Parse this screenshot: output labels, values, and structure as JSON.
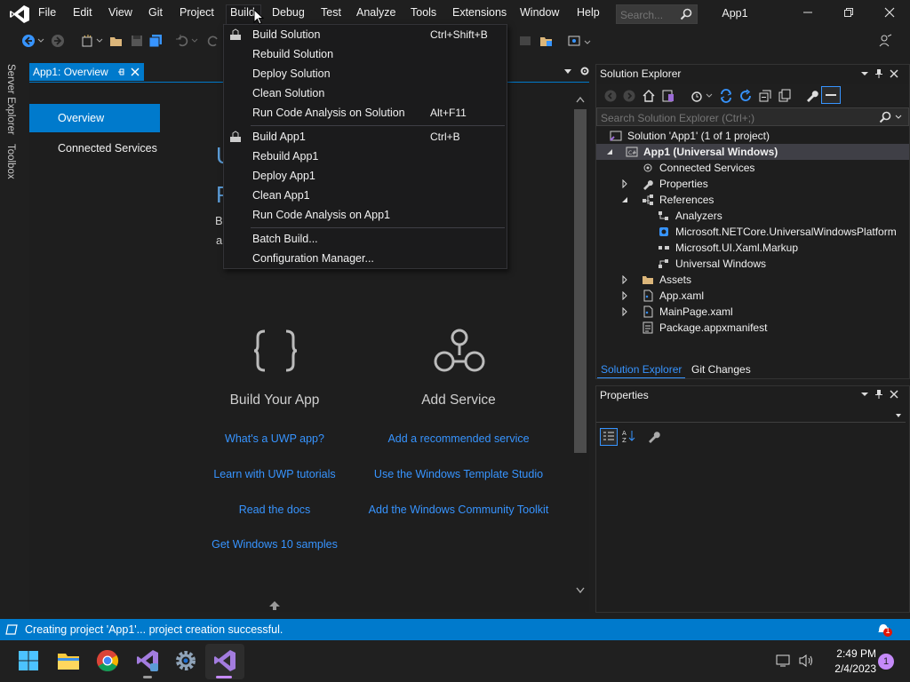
{
  "window": {
    "title": "App1"
  },
  "menubar": {
    "items": [
      "File",
      "Edit",
      "View",
      "Git",
      "Project",
      "Build",
      "Debug",
      "Test",
      "Analyze",
      "Tools",
      "Extensions",
      "Window",
      "Help"
    ],
    "search_placeholder": "Search..."
  },
  "left_strip": {
    "tabs": [
      "Server Explorer",
      "Toolbox"
    ]
  },
  "document_tab": {
    "label": "App1: Overview"
  },
  "overview": {
    "nav": [
      "Overview",
      "Connected Services"
    ],
    "partial_heading_1": "U",
    "partial_heading_2": "P",
    "partial_text_1": "B",
    "partial_text_2": "a",
    "cards": [
      {
        "title": "Build Your App",
        "links": [
          "What's a UWP app?",
          "Learn with UWP tutorials",
          "Read the docs",
          "Get Windows 10 samples"
        ]
      },
      {
        "title": "Add Service",
        "links": [
          "Add a recommended service",
          "Use the Windows Template Studio",
          "Add the Windows Community Toolkit"
        ]
      }
    ]
  },
  "build_menu": {
    "items": [
      {
        "label": "Build Solution",
        "shortcut": "Ctrl+Shift+B",
        "icon": "build-icon"
      },
      {
        "label": "Rebuild Solution",
        "shortcut": ""
      },
      {
        "label": "Deploy Solution",
        "shortcut": ""
      },
      {
        "label": "Clean Solution",
        "shortcut": ""
      },
      {
        "label": "Run Code Analysis on Solution",
        "shortcut": "Alt+F11"
      },
      {
        "label": "Build App1",
        "shortcut": "Ctrl+B",
        "icon": "build-icon"
      },
      {
        "label": "Rebuild App1",
        "shortcut": ""
      },
      {
        "label": "Deploy App1",
        "shortcut": ""
      },
      {
        "label": "Clean App1",
        "shortcut": ""
      },
      {
        "label": "Run Code Analysis on App1",
        "shortcut": ""
      },
      {
        "label": "Batch Build...",
        "shortcut": ""
      },
      {
        "label": "Configuration Manager...",
        "shortcut": ""
      }
    ]
  },
  "solution_explorer": {
    "title": "Solution Explorer",
    "search_placeholder": "Search Solution Explorer (Ctrl+;)",
    "tree": [
      {
        "label": "Solution 'App1' (1 of 1 project)",
        "icon": "solution-icon"
      },
      {
        "label": "App1 (Universal Windows)",
        "icon": "csharp-project-icon"
      },
      {
        "label": "Connected Services",
        "icon": "connected-services-icon"
      },
      {
        "label": "Properties",
        "icon": "wrench-icon"
      },
      {
        "label": "References",
        "icon": "references-icon"
      },
      {
        "label": "Analyzers",
        "icon": "analyzer-icon"
      },
      {
        "label": "Microsoft.NETCore.UniversalWindowsPlatform",
        "icon": "package-icon"
      },
      {
        "label": "Microsoft.UI.Xaml.Markup",
        "icon": "reference-icon"
      },
      {
        "label": "Universal Windows",
        "icon": "reference-icon"
      },
      {
        "label": "Assets",
        "icon": "folder-icon"
      },
      {
        "label": "App.xaml",
        "icon": "xaml-file-icon"
      },
      {
        "label": "MainPage.xaml",
        "icon": "xaml-file-icon"
      },
      {
        "label": "Package.appxmanifest",
        "icon": "manifest-icon"
      }
    ],
    "tabs": [
      "Solution Explorer",
      "Git Changes"
    ]
  },
  "properties": {
    "title": "Properties"
  },
  "statusbar": {
    "text": "Creating project 'App1'... project creation successful.",
    "notification_count": "1"
  },
  "taskbar": {
    "time": "2:49 PM",
    "date": "2/4/2023",
    "badge": "1"
  },
  "colors": {
    "accent": "#007acc",
    "link": "#3794ff",
    "menu_bg": "#1b1b1c"
  }
}
